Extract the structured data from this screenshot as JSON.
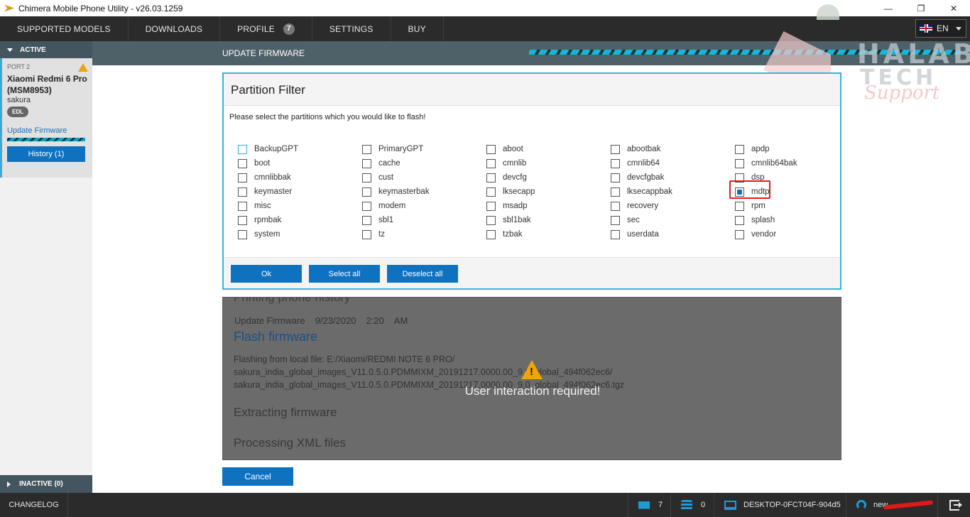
{
  "window": {
    "title": "Chimera Mobile Phone Utility - v26.03.1259",
    "controls": {
      "minimize": "—",
      "restore": "❐",
      "close": "✕"
    }
  },
  "nav": {
    "items": [
      "SUPPORTED MODELS",
      "DOWNLOADS",
      "PROFILE",
      "SETTINGS",
      "BUY"
    ],
    "profile_badge": "7",
    "language": "EN"
  },
  "sidebar": {
    "active_label": "ACTIVE",
    "device": {
      "port": "PORT 2",
      "name": "Xiaomi Redmi 6 Pro (MSM8953)",
      "codename": "sakura",
      "mode_badge": "EDL",
      "operation": "Update Firmware",
      "history_button": "History (1)"
    },
    "inactive_label": "INACTIVE (0)"
  },
  "header": {
    "title": "UPDATE FIRMWARE"
  },
  "watermark": {
    "line1": "HALAB",
    "line2": "TECH",
    "line3": "Support"
  },
  "dialog": {
    "title": "Partition Filter",
    "instruction": "Please select the partitions which you would like to flash!",
    "partitions": [
      {
        "label": "BackupGPT",
        "checked": false
      },
      {
        "label": "PrimaryGPT",
        "checked": false
      },
      {
        "label": "aboot",
        "checked": false
      },
      {
        "label": "abootbak",
        "checked": false
      },
      {
        "label": "apdp",
        "checked": false
      },
      {
        "label": "boot",
        "checked": false
      },
      {
        "label": "cache",
        "checked": false
      },
      {
        "label": "cmnlib",
        "checked": false
      },
      {
        "label": "cmnlib64",
        "checked": false
      },
      {
        "label": "cmnlib64bak",
        "checked": false
      },
      {
        "label": "cmnlibbak",
        "checked": false
      },
      {
        "label": "cust",
        "checked": false
      },
      {
        "label": "devcfg",
        "checked": false
      },
      {
        "label": "devcfgbak",
        "checked": false
      },
      {
        "label": "dsp",
        "checked": false
      },
      {
        "label": "keymaster",
        "checked": false
      },
      {
        "label": "keymasterbak",
        "checked": false
      },
      {
        "label": "lksecapp",
        "checked": false
      },
      {
        "label": "lksecappbak",
        "checked": false
      },
      {
        "label": "mdtp",
        "checked": true
      },
      {
        "label": "misc",
        "checked": false
      },
      {
        "label": "modem",
        "checked": false
      },
      {
        "label": "msadp",
        "checked": false
      },
      {
        "label": "recovery",
        "checked": false
      },
      {
        "label": "rpm",
        "checked": false
      },
      {
        "label": "rpmbak",
        "checked": false
      },
      {
        "label": "sbl1",
        "checked": false
      },
      {
        "label": "sbl1bak",
        "checked": false
      },
      {
        "label": "sec",
        "checked": false
      },
      {
        "label": "splash",
        "checked": false
      },
      {
        "label": "system",
        "checked": false
      },
      {
        "label": "tz",
        "checked": false
      },
      {
        "label": "tzbak",
        "checked": false
      },
      {
        "label": "userdata",
        "checked": false
      },
      {
        "label": "vendor",
        "checked": false
      }
    ],
    "buttons": {
      "ok": "Ok",
      "select_all": "Select all",
      "deselect_all": "Deselect all"
    }
  },
  "log": {
    "printing": "Printing phone history",
    "entry_operation": "Update Firmware",
    "entry_date": "9/23/2020",
    "entry_time": "2:20",
    "entry_ampm": "AM",
    "flash_heading": "Flash firmware",
    "local_file_line1": "Flashing from local file: E:/Xiaomi/REDMI NOTE 6 PRO/",
    "local_file_line2": "sakura_india_global_images_V11.0.5.0.PDMMIXM_20191217.0000.00_9.0_global_494f062ec6/",
    "local_file_line3": "sakura_india_global_images_V11.0.5.0.PDMMIXM_20191217.0000.00_9.0_global_494f062ec6.tgz",
    "user_required": "User interaction required!",
    "extracting": "Extracting firmware",
    "processing": "Processing XML files",
    "cancel_button": "Cancel"
  },
  "statusbar": {
    "changelog": "CHANGELOG",
    "messages_count": "7",
    "credits": "0",
    "computer": "DESKTOP-0FCT04F-904d5",
    "user": "new..."
  }
}
